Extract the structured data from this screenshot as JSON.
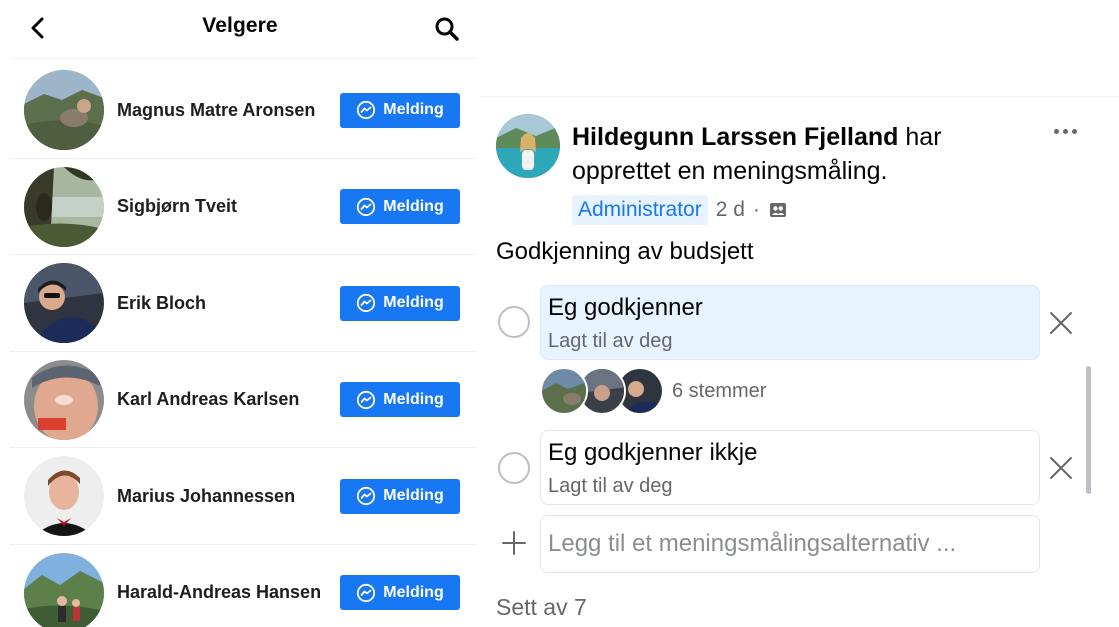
{
  "voters_panel": {
    "title": "Velgere",
    "back_icon": "chevron-left-icon",
    "search_icon": "search-icon",
    "voters": [
      {
        "name": "Magnus Matre Aronsen",
        "button": "Melding"
      },
      {
        "name": "Sigbjørn Tveit",
        "button": "Melding"
      },
      {
        "name": "Erik Bloch",
        "button": "Melding"
      },
      {
        "name": "Karl Andreas Karlsen",
        "button": "Melding"
      },
      {
        "name": "Marius Johannessen",
        "button": "Melding"
      },
      {
        "name": "Harald-Andreas Hansen",
        "button": "Melding"
      }
    ],
    "button_icon": "messenger-icon"
  },
  "post": {
    "author": "Hildegunn Larssen Fjelland",
    "action_text": " har opprettet en meningsmåling.",
    "badge": "Administrator",
    "time": "2 d",
    "separator": "·",
    "audience_icon": "group-audience-icon",
    "more_icon": "more-dots-icon"
  },
  "poll": {
    "question": "Godkjenning av budsjett",
    "options": [
      {
        "label": "Eg godkjenner",
        "sub": "Lagt til av deg"
      },
      {
        "label": "Eg godkjenner ikkje",
        "sub": "Lagt til av deg"
      }
    ],
    "votes_label": "6 stemmer",
    "add_placeholder": "Legg til et meningsmålingsalternativ ...",
    "seen_by": "Sett av 7"
  },
  "colors": {
    "accent": "#1877f2",
    "selected_option_bg": "#e7f3ff",
    "secondary_text": "#65676b"
  }
}
